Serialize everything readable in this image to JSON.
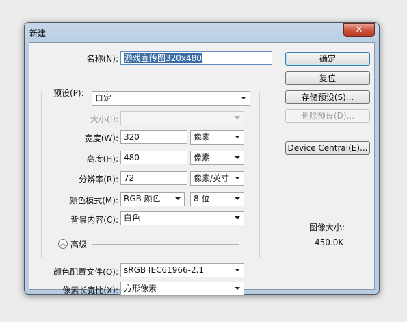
{
  "window": {
    "title": "新建",
    "close_glyph": "✕"
  },
  "form": {
    "name_label": "名称(N):",
    "name_value": "游戏宣传图320x480",
    "preset_label": "预设(P):",
    "preset_value": "自定",
    "size_label": "大小(I):",
    "size_value": "",
    "width_label": "宽度(W):",
    "width_value": "320",
    "width_unit": "像素",
    "height_label": "高度(H):",
    "height_value": "480",
    "height_unit": "像素",
    "resolution_label": "分辨率(R):",
    "resolution_value": "72",
    "resolution_unit": "像素/英寸",
    "color_mode_label": "颜色模式(M):",
    "color_mode_value": "RGB 颜色",
    "bit_depth_value": "8 位",
    "background_label": "背景内容(C):",
    "background_value": "白色",
    "advanced_label": "高级",
    "advanced_glyph": "︽",
    "color_profile_label": "颜色配置文件(O):",
    "color_profile_value": "sRGB IEC61966-2.1",
    "pixel_aspect_label": "像素长宽比(X):",
    "pixel_aspect_value": "方形像素"
  },
  "buttons": {
    "ok": "确定",
    "reset": "复位",
    "save_preset": "存储预设(S)...",
    "delete_preset": "删除预设(D)...",
    "device_central": "Device Central(E)..."
  },
  "image_size": {
    "label": "图像大小:",
    "value": "450.0K"
  }
}
